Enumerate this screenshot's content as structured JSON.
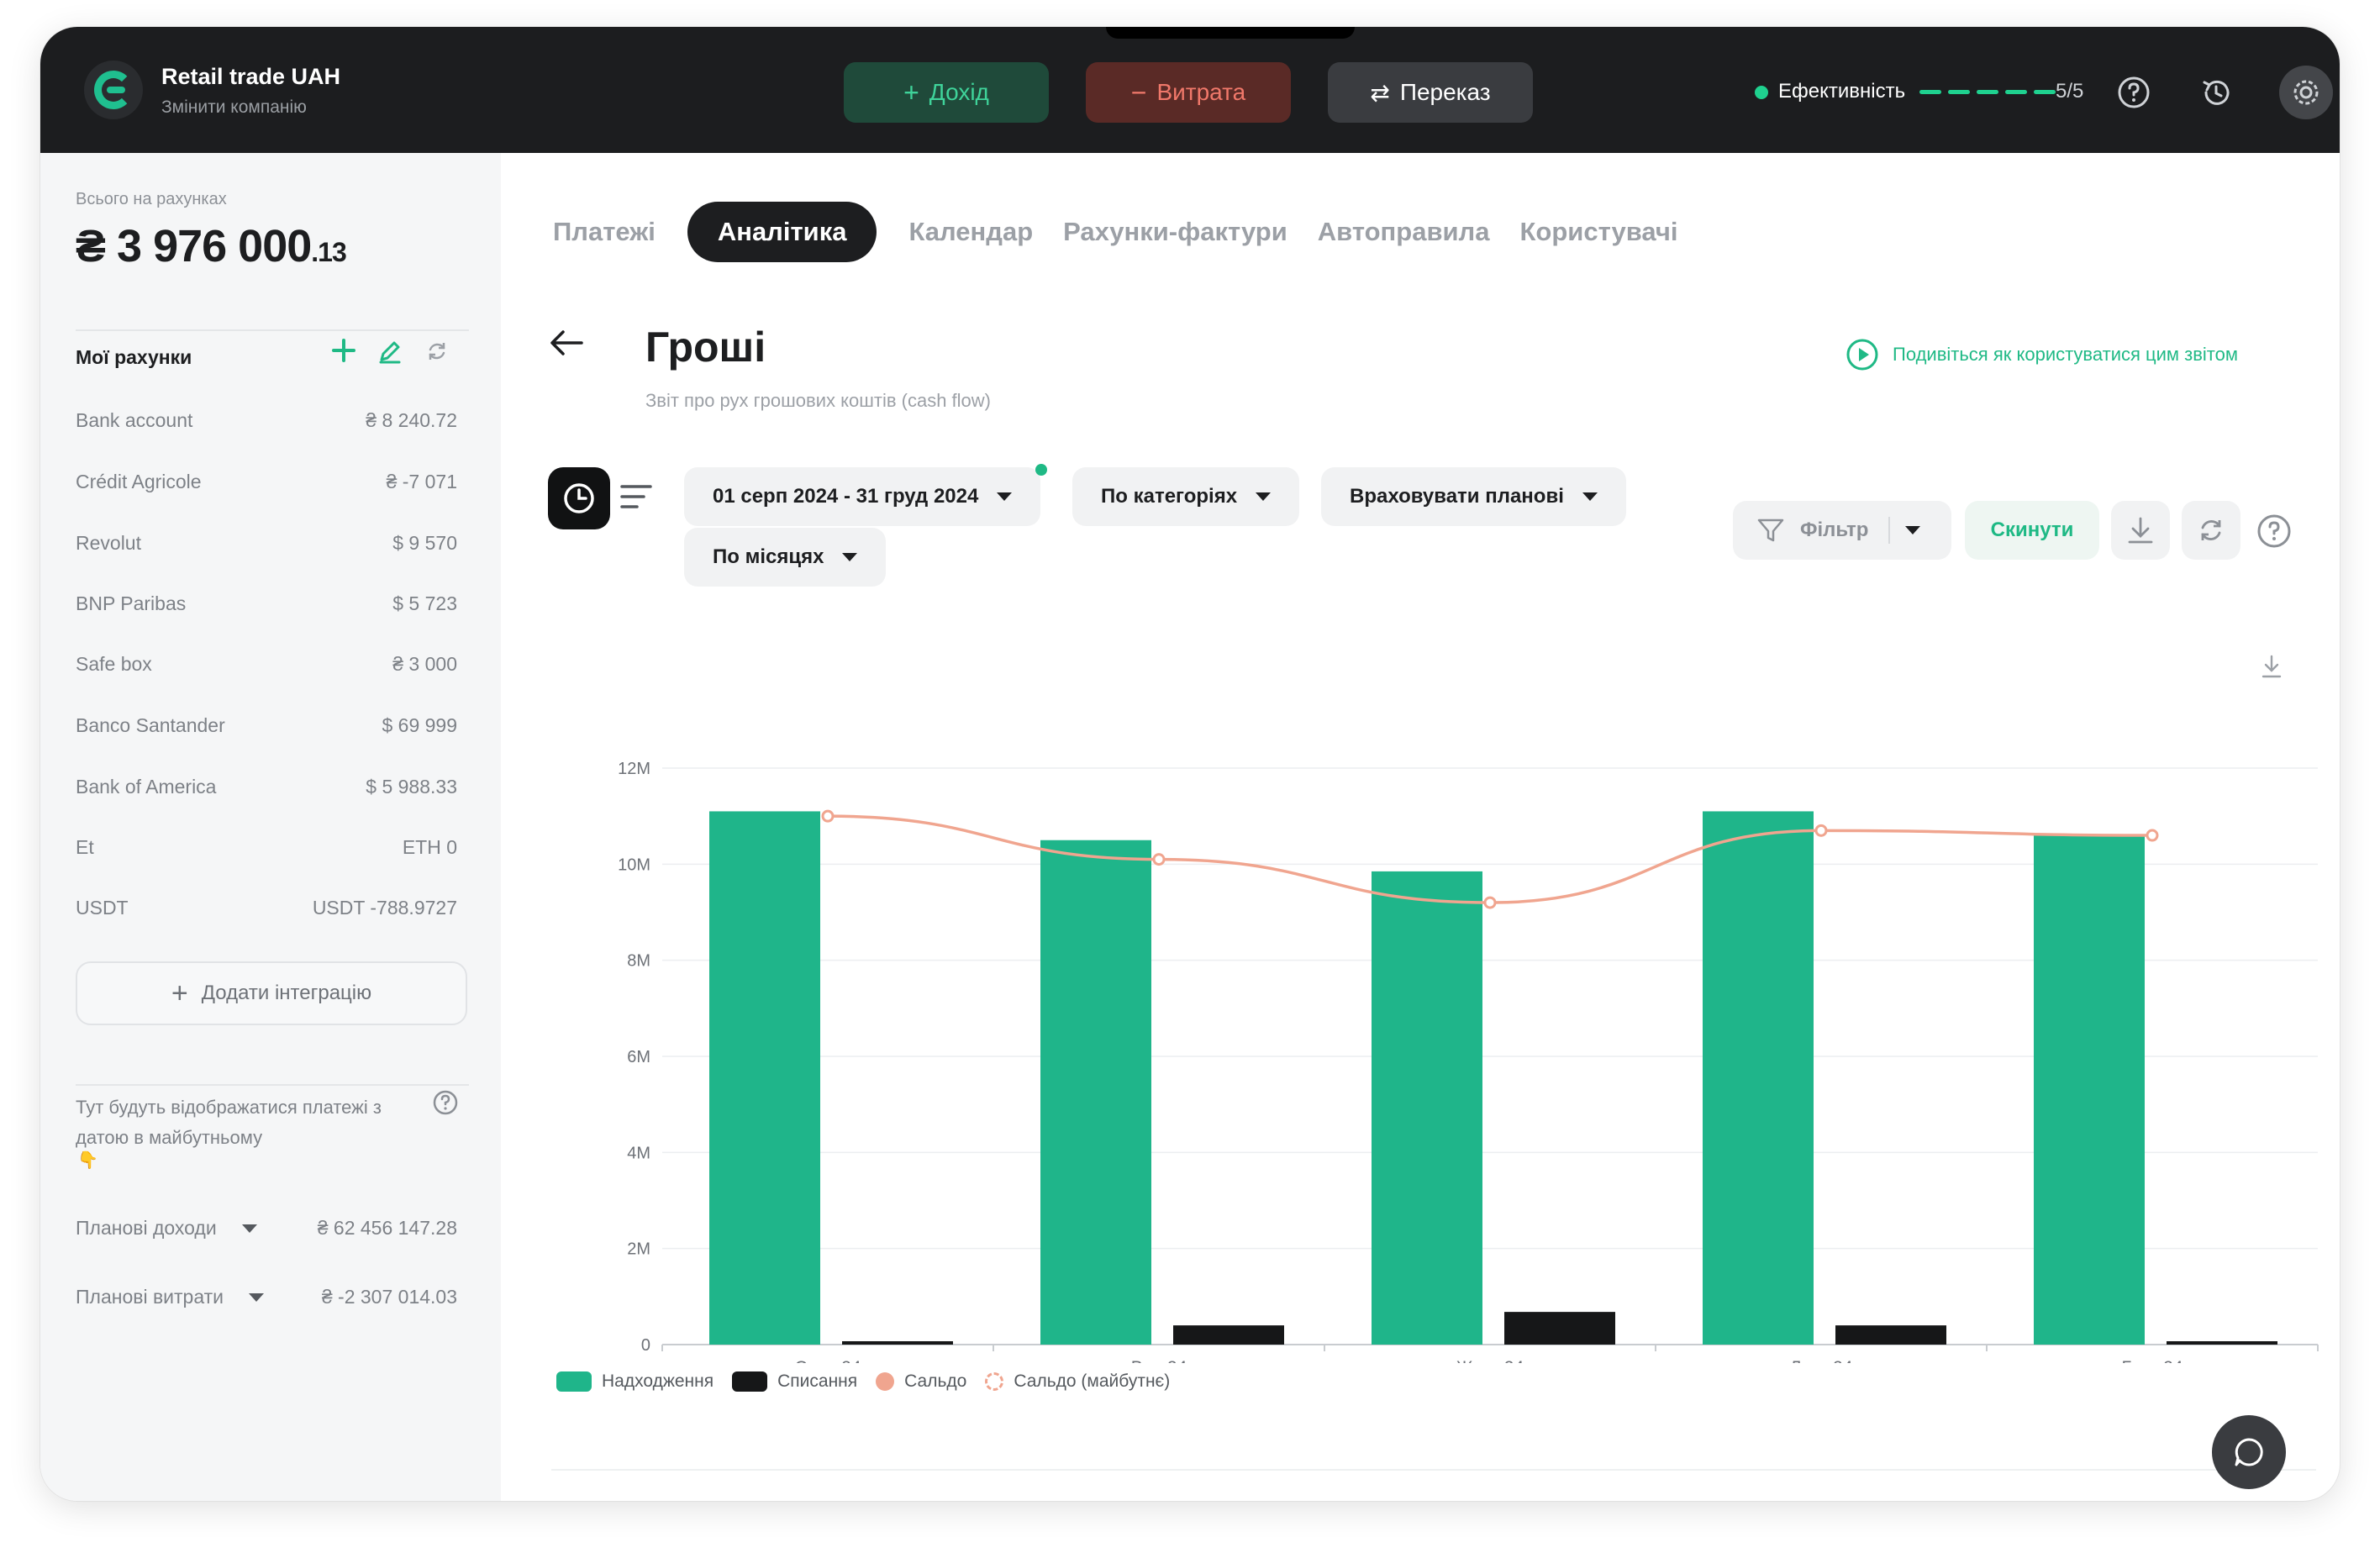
{
  "company": {
    "name": "Retail trade UAH",
    "switch_label": "Змінити компанію"
  },
  "top_actions": {
    "income": "Дохід",
    "expense": "Витрата",
    "transfer": "Переказ"
  },
  "efficiency": {
    "label": "Ефективність",
    "score": "5/5",
    "color": "#1fd18f"
  },
  "sidebar": {
    "total_label": "Всього на рахунках",
    "total_currency": "₴",
    "total_main": "3 976 000",
    "total_cents": ".13",
    "accounts_title": "Мої рахунки",
    "accounts": [
      {
        "name": "Bank account",
        "value": "₴ 8 240.72"
      },
      {
        "name": "Crédit Agricole",
        "value": "₴ -7 071"
      },
      {
        "name": "Revolut",
        "value": "$ 9 570"
      },
      {
        "name": "BNP Paribas",
        "value": "$ 5 723"
      },
      {
        "name": "Safe box",
        "value": "₴ 3 000"
      },
      {
        "name": "Banco Santander",
        "value": "$ 69 999"
      },
      {
        "name": "Bank of America",
        "value": "$ 5 988.33"
      },
      {
        "name": "Et",
        "value": "ETH 0"
      },
      {
        "name": "USDT",
        "value": "USDT -788.9727"
      }
    ],
    "add_integration": "Додати інтеграцію",
    "future_text": "Тут будуть відображатися платежі з датою в майбутньому",
    "planned_income_label": "Планові доходи",
    "planned_income_value": "₴ 62 456 147.28",
    "planned_expense_label": "Планові витрати",
    "planned_expense_value": "₴ -2 307 014.03"
  },
  "tabs": [
    "Платежі",
    "Аналітика",
    "Календар",
    "Рахунки-фактури",
    "Автоправила",
    "Користувачі"
  ],
  "active_tab": "Аналітика",
  "page": {
    "title": "Гроші",
    "subtitle": "Звіт про рух грошових коштів (cash flow)",
    "howto": "Подивіться як користуватися цим звітом"
  },
  "filters": {
    "date_range": "01 серп 2024 - 31 груд 2024",
    "group_by": "По категоріях",
    "planned": "Враховувати планові",
    "period": "По місяцях",
    "filter": "Фільтр",
    "reset": "Скинути"
  },
  "chart_data": {
    "type": "bar",
    "categories": [
      "Серп 24",
      "Вер 24",
      "Жовт 24",
      "Лист 24",
      "Груд 24"
    ],
    "series": [
      {
        "name": "Надходження",
        "type": "bar",
        "color": "#1fb58a",
        "values": [
          11.1,
          10.5,
          9.85,
          11.1,
          10.6
        ]
      },
      {
        "name": "Списання",
        "type": "bar",
        "color": "#161718",
        "values": [
          0.07,
          0.4,
          0.68,
          0.4,
          0.07
        ]
      },
      {
        "name": "Сальдо",
        "type": "line",
        "color": "#f0a58f",
        "values": [
          11.0,
          10.1,
          9.2,
          10.7,
          10.6
        ]
      },
      {
        "name": "Сальдо (майбутнє)",
        "type": "line-dashed",
        "color": "#f0a58f",
        "values": []
      }
    ],
    "y_ticks": [
      "0",
      "2M",
      "4M",
      "6M",
      "8M",
      "10M",
      "12M"
    ],
    "ylim": [
      0,
      12
    ],
    "grid": true,
    "legend_position": "bottom-left"
  }
}
